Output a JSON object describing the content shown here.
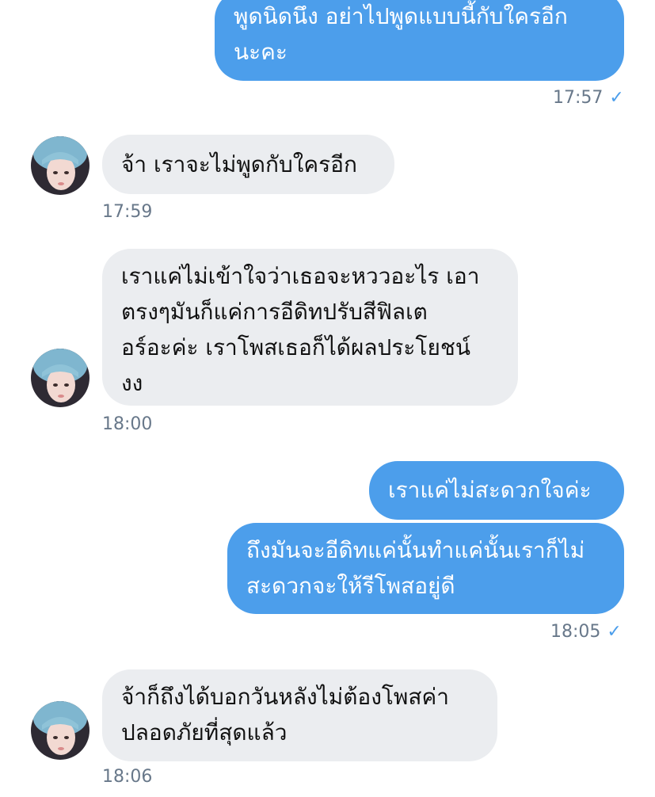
{
  "messages": [
    {
      "id": "m1",
      "direction": "sent",
      "text": "พูดนิดนึง อย่าไปพูดแบบนี้กับใครอีก\nนะคะ"
    },
    {
      "id": "m2",
      "direction": "received",
      "text": "จ้า เราจะไม่พูดกับใครอีก"
    },
    {
      "id": "m3",
      "direction": "received",
      "text": "เราแค่ไม่เข้าใจว่าเธอจะหววอะไร เอา\nตรงๆมันก็แค่การอีดิทปรับสีฟิลเต\nอร์อะค่ะ เราโพสเธอก็ได้ผลประโยชน์\nงง"
    },
    {
      "id": "m4",
      "direction": "sent",
      "text": "เราแค่ไม่สะดวกใจค่ะ"
    },
    {
      "id": "m5",
      "direction": "sent",
      "text": "ถึงมันจะอีดิทแค่นั้นทำแค่นั้นเราก็ไม่\nสะดวกจะให้รีโพสอยู่ดี"
    },
    {
      "id": "m6",
      "direction": "received",
      "text": "จ้าก็ถึงได้บอกวันหลังไม่ต้องโพสค่า\nปลอดภัยที่สุดแล้ว"
    }
  ],
  "timestamps": {
    "t1": "17:57",
    "t2": "17:59",
    "t3": "18:00",
    "t4": "18:05",
    "t5": "18:06"
  },
  "read_receipt_icon": "checkmark-icon",
  "read_receipt_glyph": "✓",
  "colors": {
    "sent_bubble": "#4c9eeb",
    "received_bubble": "#ebedf0",
    "timestamp": "#68788a",
    "accent": "#4c9eeb"
  }
}
